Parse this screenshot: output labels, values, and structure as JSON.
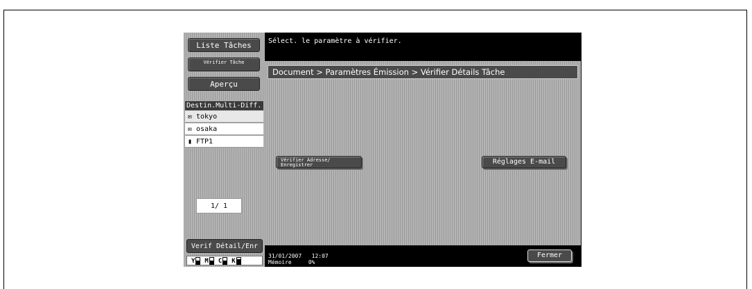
{
  "sidebar": {
    "liste_taches": "Liste Tâches",
    "verifier_tache": "Vérifier Tâche",
    "apercu": "Aperçu",
    "dest_header": "Destin.Multi-Diff.",
    "destinations": [
      {
        "icon": "email-icon",
        "glyph": "✉",
        "label": "tokyo"
      },
      {
        "icon": "email-icon",
        "glyph": "✉",
        "label": "osaka"
      },
      {
        "icon": "ftp-icon",
        "glyph": "▮",
        "label": "FTP1"
      }
    ],
    "page_indicator": "1/  1",
    "verif_detail": "Verif Détail/Enr",
    "toner": [
      {
        "label": "Y",
        "level": 0.6
      },
      {
        "label": "M",
        "level": 0.6
      },
      {
        "label": "C",
        "level": 0.6
      },
      {
        "label": "K",
        "level": 0.8
      }
    ]
  },
  "header": {
    "message": "Sélect. le paramètre à vérifier."
  },
  "main": {
    "breadcrumb": "Document > Paramètres Émission > Vérifier Détails Tâche",
    "verifier_adresse_line1": "Vérifier Adresse/",
    "verifier_adresse_line2": "Enregistrer",
    "reglages_email": "Réglages E-mail"
  },
  "footer": {
    "date": "31/01/2007",
    "time": "12:07",
    "memoire_label": "Mémoire",
    "memoire_value": "0%",
    "fermer": "Fermer"
  },
  "colors": {
    "panel_black": "#000000",
    "button_gray": "#4a4a4a",
    "stripe_gray": "#b4b4b4"
  }
}
